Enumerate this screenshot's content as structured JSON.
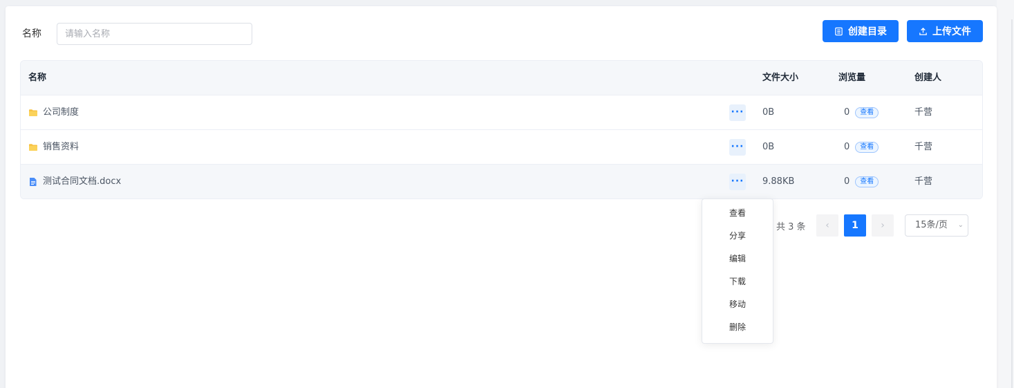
{
  "filter": {
    "label": "名称",
    "placeholder": "请输入名称"
  },
  "toolbar": {
    "create_dir_label": "创建目录",
    "upload_label": "上传文件"
  },
  "table": {
    "headers": {
      "name": "名称",
      "size": "文件大小",
      "views": "浏览量",
      "creator": "创建人"
    },
    "rows": [
      {
        "icon": "folder-icon",
        "name": "公司制度",
        "size": "0B",
        "views": "0",
        "view_tag": "查看",
        "creator": "千营"
      },
      {
        "icon": "folder-icon",
        "name": "销售资料",
        "size": "0B",
        "views": "0",
        "view_tag": "查看",
        "creator": "千营"
      },
      {
        "icon": "document-icon",
        "name": "测试合同文档.docx",
        "size": "9.88KB",
        "views": "0",
        "view_tag": "查看",
        "creator": "千营"
      }
    ],
    "more_label": "···"
  },
  "pagination": {
    "total_text": "共 3 条",
    "current_page": "1",
    "page_size": "15条/页"
  },
  "dropdown_menu": {
    "items": [
      "查看",
      "分享",
      "编辑",
      "下载",
      "移动",
      "删除"
    ]
  },
  "colors": {
    "primary": "#1677ff",
    "folder": "#f7c244",
    "document": "#4a8df8"
  }
}
